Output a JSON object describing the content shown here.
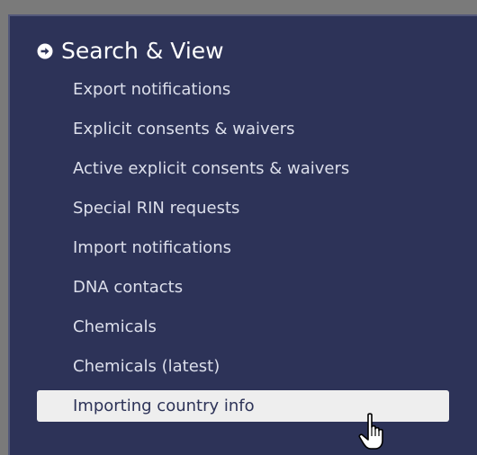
{
  "section": {
    "title": "Search & View",
    "icon": "circle-arrow-right-icon"
  },
  "menu": {
    "items": [
      {
        "label": "Export notifications"
      },
      {
        "label": "Explicit consents & waivers"
      },
      {
        "label": "Active explicit consents & waivers"
      },
      {
        "label": "Special RIN requests"
      },
      {
        "label": "Import notifications"
      },
      {
        "label": "DNA contacts"
      },
      {
        "label": "Chemicals"
      },
      {
        "label": "Chemicals (latest)"
      },
      {
        "label": "Importing country info",
        "active": true
      }
    ]
  },
  "colors": {
    "panel_background": "#2d3358",
    "outer_background": "#7a7a7a",
    "item_text": "#dcdfeb",
    "active_background": "#eeeeee"
  },
  "cursor": {
    "icon": "hand-pointer-icon"
  }
}
